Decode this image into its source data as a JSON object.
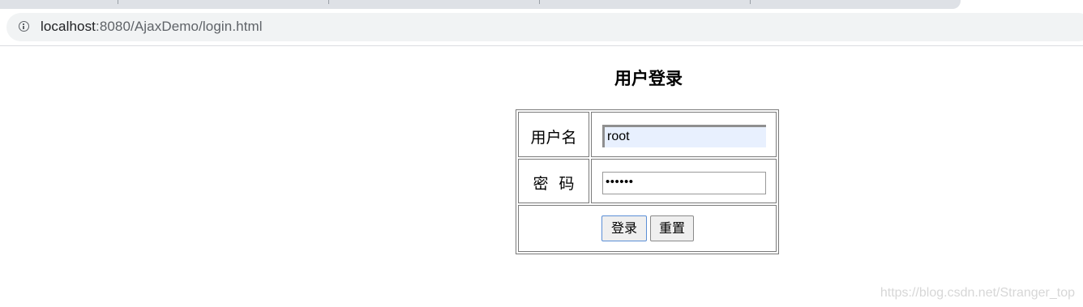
{
  "browser": {
    "url_host": "localhost",
    "url_rest": ":8080/AjaxDemo/login.html"
  },
  "page": {
    "title": "用户登录",
    "username_label": "用户名",
    "username_value": "root",
    "password_label": "密码",
    "password_masked": "••••••",
    "login_button": "登录",
    "reset_button": "重置"
  },
  "watermark": "https://blog.csdn.net/Stranger_top"
}
